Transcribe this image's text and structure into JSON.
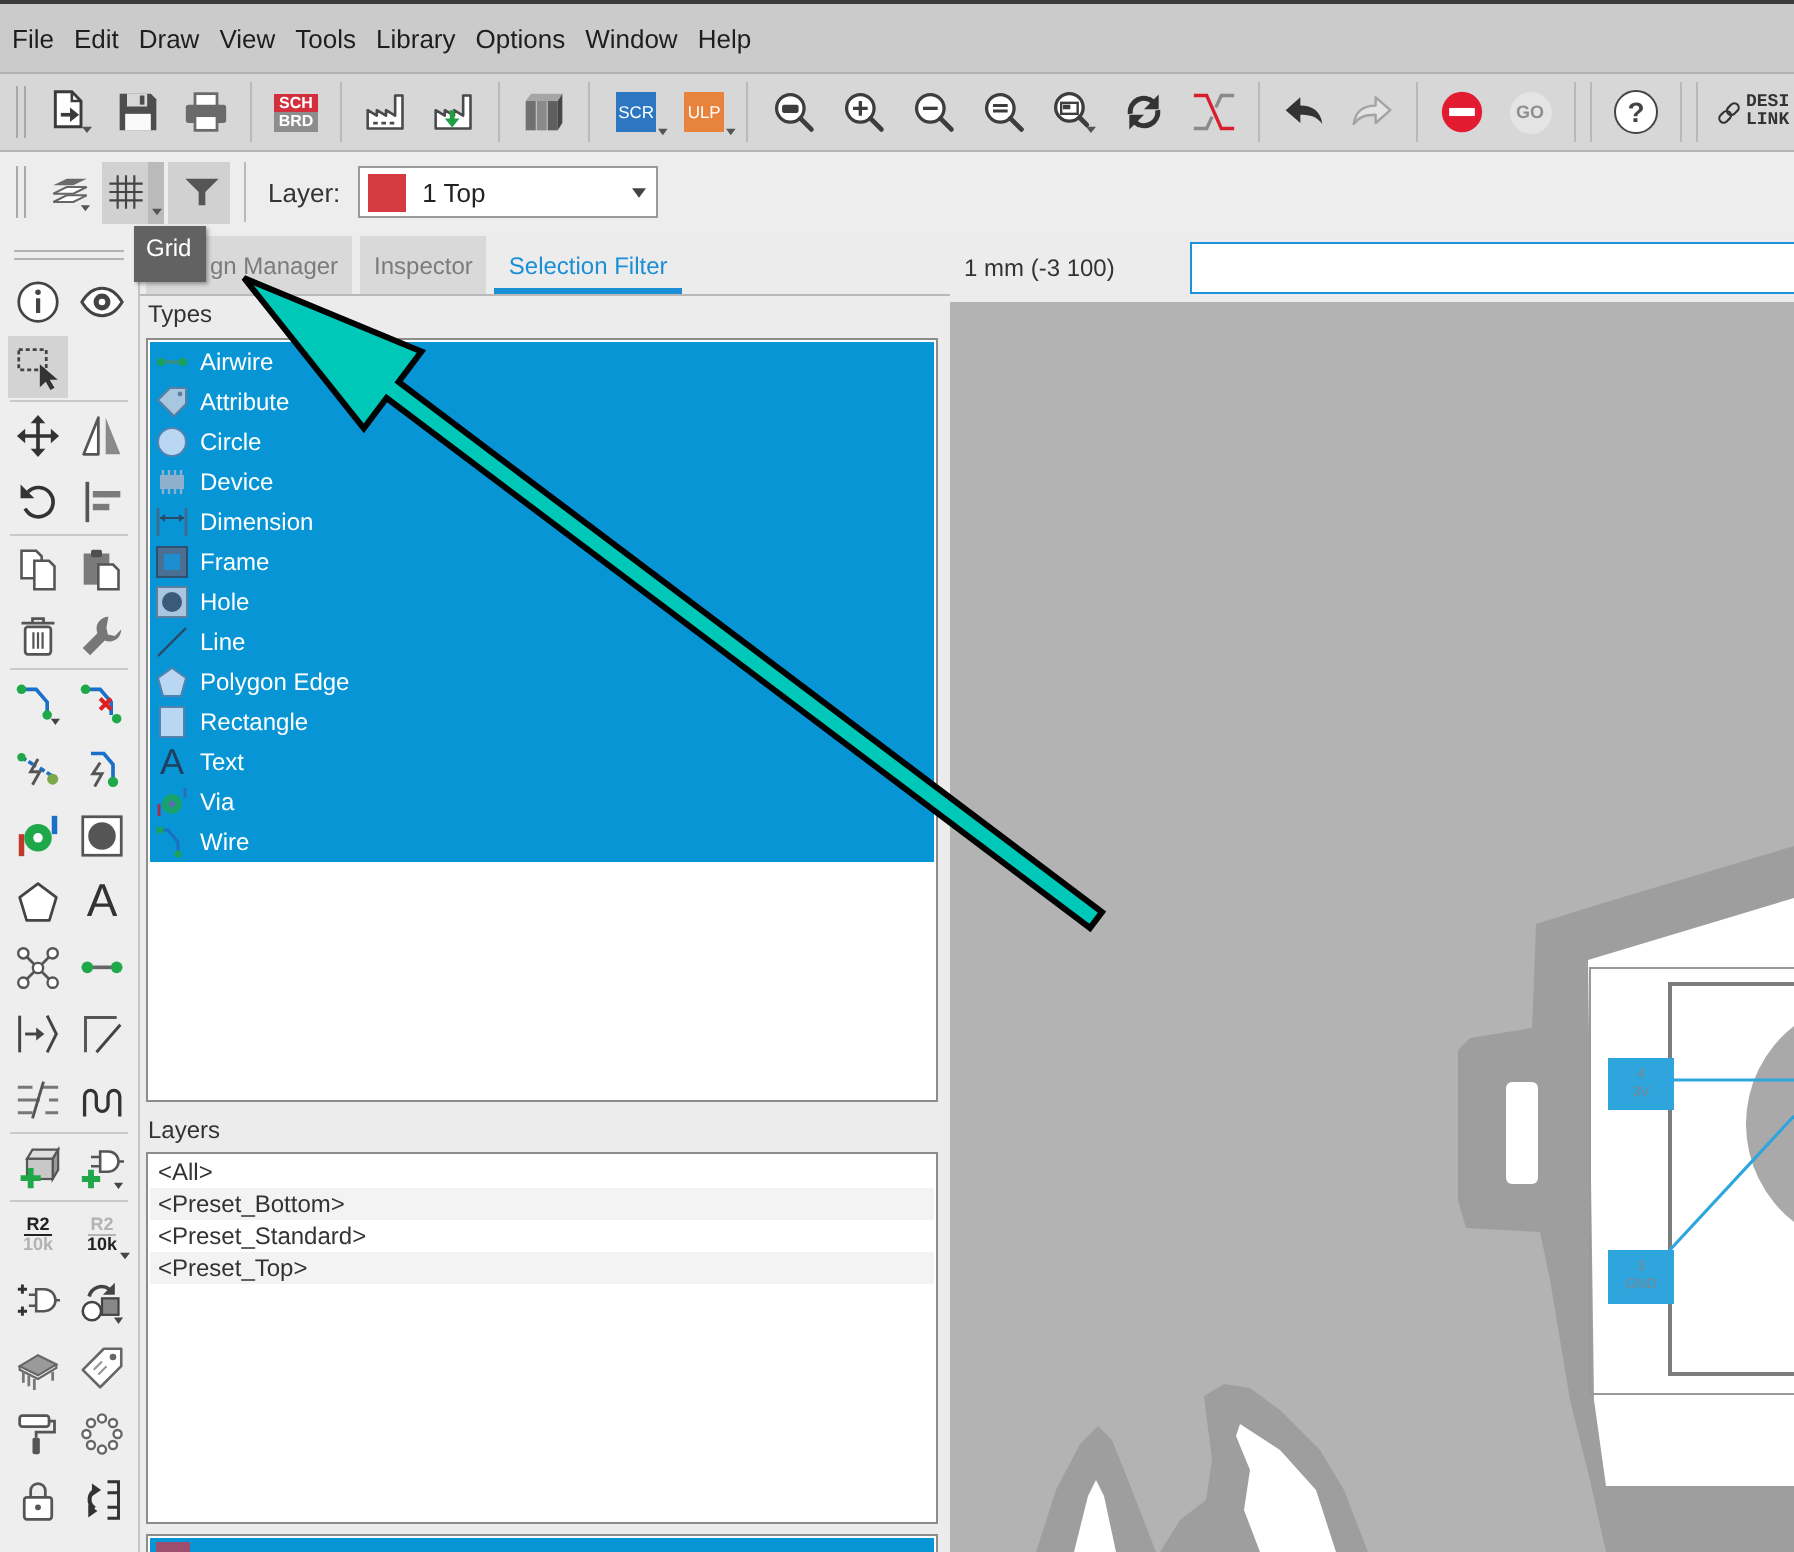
{
  "menu": [
    "File",
    "Edit",
    "Draw",
    "View",
    "Tools",
    "Library",
    "Options",
    "Window",
    "Help"
  ],
  "toolbar": [
    [
      {
        "disabled": false
      },
      {
        "disabled": false
      },
      {
        "disabled": false
      }
    ],
    [
      {
        "lines": [
          "SCH",
          "BRD"
        ],
        "disabled": false
      }
    ],
    [
      {
        "disabled": false
      },
      {
        "disabled": false
      }
    ],
    [
      {
        "disabled": false
      }
    ],
    [
      {
        "text": "SCR",
        "disabled": false
      },
      {
        "text": "ULP",
        "disabled": false
      }
    ],
    [
      {
        "disabled": false
      },
      {
        "disabled": false
      },
      {
        "disabled": false
      },
      {
        "disabled": false
      },
      {
        "disabled": false
      },
      {
        "disabled": false
      },
      {
        "disabled": false
      }
    ],
    [
      {
        "disabled": false
      },
      {
        "disabled": true
      }
    ],
    [
      {
        "disabled": false
      },
      {
        "text": "GO",
        "disabled": true
      }
    ],
    [
      {
        "text": "?",
        "disabled": false
      }
    ],
    [
      {
        "lines": [
          "DESI",
          "LINK"
        ],
        "disabled": false
      }
    ]
  ],
  "toolbar2": {
    "buttons": [
      {
        "on": false
      },
      {
        "on": true
      },
      {
        "on": true
      }
    ],
    "layer_label": "Layer:",
    "layer_select": {
      "color": "#d43a40",
      "value": "1 Top"
    }
  },
  "tooltip": {
    "text": "Grid"
  },
  "palette": [
    [
      [
        {
          "selected": false
        },
        {
          "selected": false
        }
      ],
      [
        {
          "selected": true
        }
      ]
    ],
    [
      [
        {
          "selected": false
        },
        {
          "selected": false
        }
      ],
      [
        {
          "selected": false
        },
        {
          "selected": false
        }
      ]
    ],
    [
      [
        {
          "selected": false
        },
        {
          "selected": false
        }
      ],
      [
        {
          "selected": false
        },
        {
          "selected": false
        }
      ]
    ],
    [
      [
        {
          "selected": false
        },
        {
          "selected": false
        }
      ],
      [
        {
          "selected": false
        },
        {
          "selected": false
        }
      ],
      [
        {
          "selected": false
        },
        {
          "selected": false
        }
      ],
      [
        {
          "selected": false
        },
        {
          "selected": false,
          "glyph": "A"
        }
      ],
      [
        {
          "selected": false
        },
        {
          "selected": false
        }
      ],
      [
        {
          "selected": false
        },
        {
          "selected": false
        }
      ],
      [
        {
          "selected": false
        },
        {
          "selected": false
        }
      ]
    ],
    [
      [
        {
          "selected": false
        },
        {
          "selected": false
        }
      ]
    ],
    [
      [
        {
          "selected": false,
          "lines": [
            "R2",
            "10k"
          ]
        },
        {
          "selected": false,
          "lines": [
            "R2",
            "10k"
          ]
        }
      ],
      [
        {
          "selected": false
        },
        {
          "selected": false
        }
      ],
      [
        {
          "selected": false
        },
        {
          "selected": false
        }
      ],
      [
        {
          "selected": false
        },
        {
          "selected": false
        }
      ],
      [
        {
          "selected": false
        },
        {
          "selected": false
        }
      ]
    ]
  ],
  "panel": {
    "tabs": [
      {
        "label": "gn Manager",
        "selected": false
      },
      {
        "label": "Inspector",
        "selected": false
      },
      {
        "label": "Selection Filter",
        "selected": true
      }
    ],
    "types_label": "Types",
    "types": [
      {
        "label": "Airwire",
        "selected": true
      },
      {
        "label": "Attribute",
        "selected": true
      },
      {
        "label": "Circle",
        "selected": true
      },
      {
        "label": "Device",
        "selected": true
      },
      {
        "label": "Dimension",
        "selected": true
      },
      {
        "label": "Frame",
        "selected": true
      },
      {
        "label": "Hole",
        "selected": true
      },
      {
        "label": "Line",
        "selected": true
      },
      {
        "label": "Polygon Edge",
        "selected": true
      },
      {
        "label": "Rectangle",
        "selected": true
      },
      {
        "label": "Text",
        "glyph": "A",
        "selected": true
      },
      {
        "label": "Via",
        "selected": true
      },
      {
        "label": "Wire",
        "selected": true
      }
    ],
    "layers_label": "Layers",
    "layers": [
      {
        "label": "<All>",
        "selected": false
      },
      {
        "label": "<Preset_Bottom>",
        "selected": false
      },
      {
        "label": "<Preset_Standard>",
        "selected": false
      },
      {
        "label": "<Preset_Top>",
        "selected": false
      }
    ],
    "layer_rows": [
      {
        "color": "#9d4d6d",
        "selected": true
      }
    ]
  },
  "canvas": {
    "coordinates": "1 mm (-3 100)",
    "command_field": {
      "focused": true
    },
    "pads": [
      {
        "number": "4",
        "name": "3V"
      },
      {
        "number": "3",
        "name": "GND"
      }
    ]
  }
}
